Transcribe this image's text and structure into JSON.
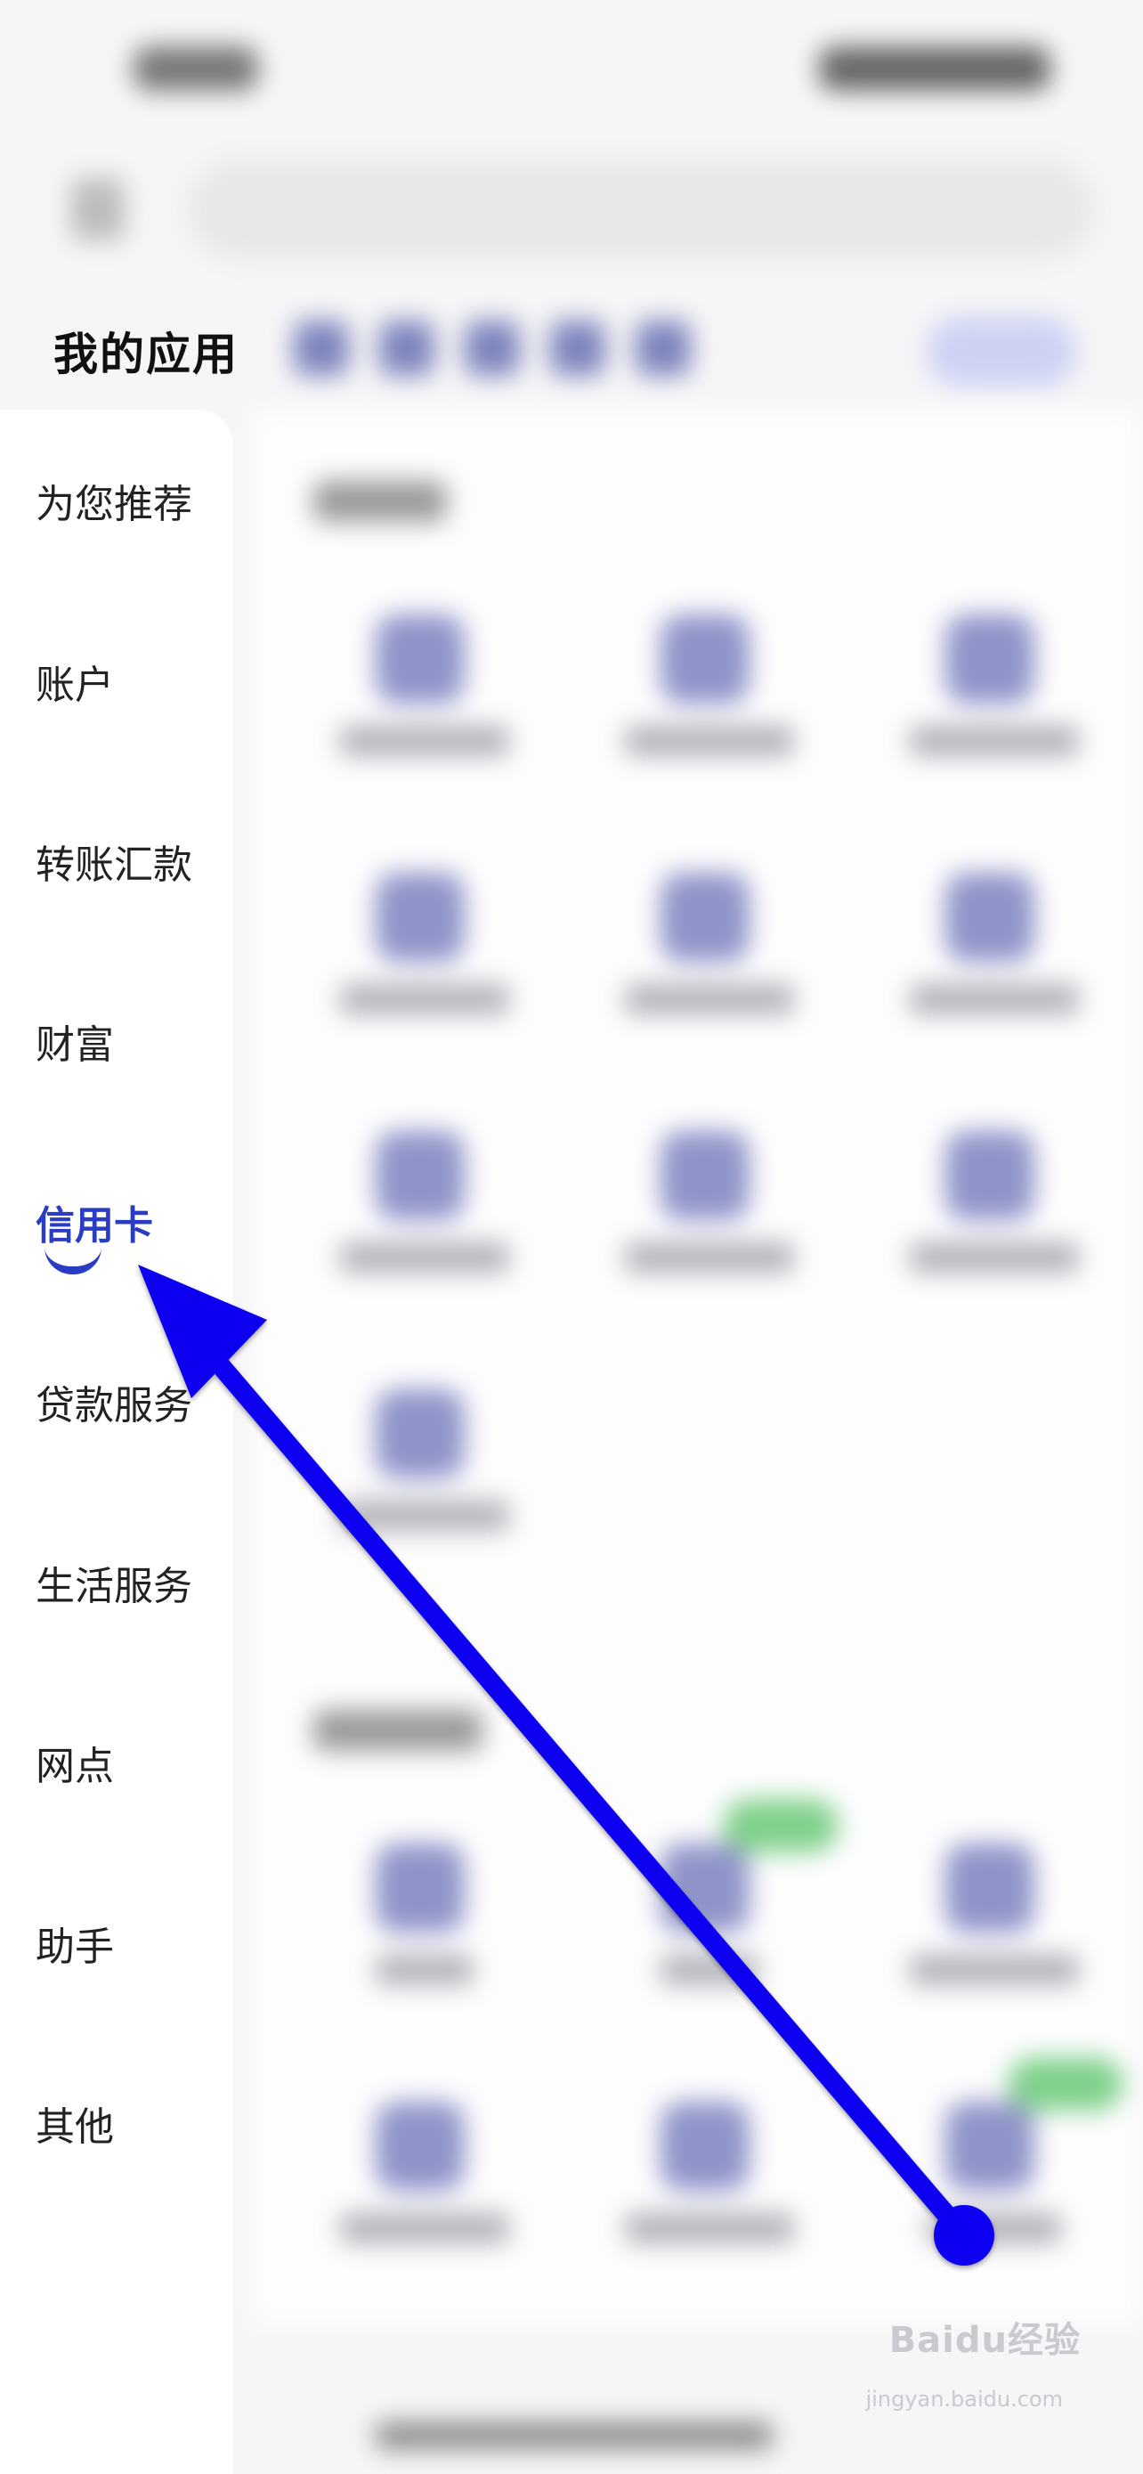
{
  "page": {
    "title": "我的应用"
  },
  "sidebar": {
    "items": [
      {
        "label": "为您推荐",
        "active": false
      },
      {
        "label": "账户",
        "active": false
      },
      {
        "label": "转账汇款",
        "active": false
      },
      {
        "label": "财富",
        "active": false
      },
      {
        "label": "信用卡",
        "active": true
      },
      {
        "label": "贷款服务",
        "active": false
      },
      {
        "label": "生活服务",
        "active": false
      },
      {
        "label": "网点",
        "active": false
      },
      {
        "label": "助手",
        "active": false
      },
      {
        "label": "其他",
        "active": false
      }
    ]
  },
  "annotation": {
    "arrow_color": "#0a00f0",
    "accent": "#2b3cc4"
  },
  "watermark": {
    "text": "Baidu经验",
    "sub": "jingyan.baidu.com"
  }
}
